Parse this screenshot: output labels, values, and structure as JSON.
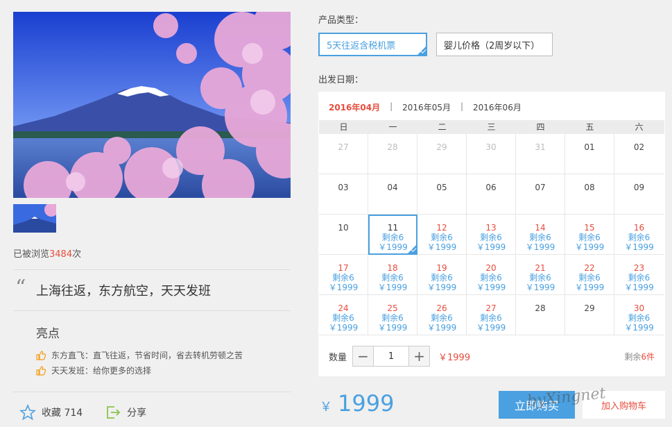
{
  "gallery": {
    "main_image": "mount-fuji-cherry-blossom",
    "thumbnail": "mount-fuji-thumbnail"
  },
  "views": {
    "prefix": "已被浏览",
    "count": "3484",
    "suffix": "次"
  },
  "headline": "上海往返，东方航空，天天发班",
  "highlights": {
    "title": "亮点",
    "items": [
      {
        "icon": "thumbs-up-icon",
        "text": "东方直飞：直飞往返，节省时间，省去转机劳顿之苦"
      },
      {
        "icon": "thumbs-up-icon",
        "text": "天天发班：给你更多的选择"
      }
    ]
  },
  "actions": {
    "favorite_label": "收藏 714",
    "share_label": "分享"
  },
  "product": {
    "type_label": "产品类型：",
    "options": [
      {
        "label": "5天往返含税机票",
        "selected": true
      },
      {
        "label": "婴儿价格（2周岁以下）",
        "selected": false
      }
    ]
  },
  "departure_label": "出发日期：",
  "calendar": {
    "months": [
      {
        "label": "2016年04月",
        "active": true
      },
      {
        "label": "2016年05月",
        "active": false
      },
      {
        "label": "2016年06月",
        "active": false
      }
    ],
    "separator": "|",
    "weekdays": [
      "日",
      "一",
      "二",
      "三",
      "四",
      "五",
      "六"
    ],
    "days": [
      {
        "d": "27",
        "state": "past"
      },
      {
        "d": "28",
        "state": "past"
      },
      {
        "d": "29",
        "state": "past"
      },
      {
        "d": "30",
        "state": "past"
      },
      {
        "d": "31",
        "state": "past"
      },
      {
        "d": "01",
        "state": "noavail"
      },
      {
        "d": "02",
        "state": "noavail"
      },
      {
        "d": "03",
        "state": "noavail"
      },
      {
        "d": "04",
        "state": "noavail"
      },
      {
        "d": "05",
        "state": "noavail"
      },
      {
        "d": "06",
        "state": "noavail"
      },
      {
        "d": "07",
        "state": "noavail"
      },
      {
        "d": "08",
        "state": "noavail"
      },
      {
        "d": "09",
        "state": "noavail"
      },
      {
        "d": "10",
        "state": "noavail"
      },
      {
        "d": "11",
        "state": "sel",
        "remain": "剩余6",
        "price": "￥1999"
      },
      {
        "d": "12",
        "state": "avail",
        "remain": "剩余6",
        "price": "￥1999"
      },
      {
        "d": "13",
        "state": "avail",
        "remain": "剩余6",
        "price": "￥1999"
      },
      {
        "d": "14",
        "state": "avail",
        "remain": "剩余6",
        "price": "￥1999"
      },
      {
        "d": "15",
        "state": "avail",
        "remain": "剩余6",
        "price": "￥1999"
      },
      {
        "d": "16",
        "state": "avail",
        "remain": "剩余6",
        "price": "￥1999"
      },
      {
        "d": "17",
        "state": "avail",
        "remain": "剩余6",
        "price": "￥1999"
      },
      {
        "d": "18",
        "state": "avail",
        "remain": "剩余6",
        "price": "￥1999"
      },
      {
        "d": "19",
        "state": "avail",
        "remain": "剩余6",
        "price": "￥1999"
      },
      {
        "d": "20",
        "state": "avail",
        "remain": "剩余6",
        "price": "￥1999"
      },
      {
        "d": "21",
        "state": "avail",
        "remain": "剩余6",
        "price": "￥1999"
      },
      {
        "d": "22",
        "state": "avail",
        "remain": "剩余6",
        "price": "￥1999"
      },
      {
        "d": "23",
        "state": "avail",
        "remain": "剩余6",
        "price": "￥1999"
      },
      {
        "d": "24",
        "state": "avail",
        "remain": "剩余6",
        "price": "￥1999"
      },
      {
        "d": "25",
        "state": "avail",
        "remain": "剩余6",
        "price": "￥1999"
      },
      {
        "d": "26",
        "state": "avail",
        "remain": "剩余6",
        "price": "￥1999"
      },
      {
        "d": "27",
        "state": "avail",
        "remain": "剩余6",
        "price": "￥1999"
      },
      {
        "d": "28",
        "state": "noavail"
      },
      {
        "d": "29",
        "state": "noavail"
      },
      {
        "d": "30",
        "state": "avail",
        "remain": "剩余6",
        "price": "￥1999"
      }
    ]
  },
  "quantity": {
    "label": "数量",
    "minus": "−",
    "value": "1",
    "plus": "+",
    "price": "￥1999",
    "stock_prefix": "剩余",
    "stock_count": "6件"
  },
  "total": {
    "currency": "￥",
    "value": "1999"
  },
  "buttons": {
    "buy": "立即购买",
    "cart": "加入购物车"
  },
  "watermark": "byXingnet",
  "colors": {
    "accent": "#4aa0e0",
    "price_red": "#e74c3c",
    "highlight_icon": "#f39c12"
  }
}
